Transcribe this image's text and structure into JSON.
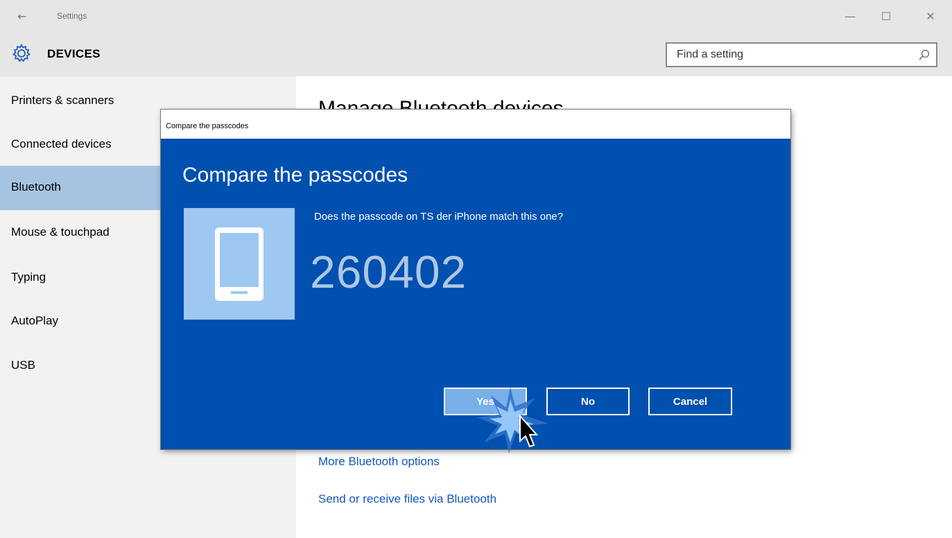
{
  "window": {
    "title": "Settings",
    "back_icon": "←",
    "minimize_icon": "—",
    "maximize_icon": "☐",
    "close_icon": "✕"
  },
  "header": {
    "title": "DEVICES",
    "search_placeholder": "Find a setting"
  },
  "sidebar": {
    "items": [
      {
        "label": "Printers & scanners"
      },
      {
        "label": "Connected devices"
      },
      {
        "label": "Bluetooth",
        "selected": true
      },
      {
        "label": "Mouse & touchpad"
      },
      {
        "label": "Typing"
      },
      {
        "label": "AutoPlay"
      },
      {
        "label": "USB"
      }
    ]
  },
  "content": {
    "heading": "Manage Bluetooth devices",
    "links": [
      "More Bluetooth options",
      "Send or receive files via Bluetooth"
    ]
  },
  "dialog": {
    "window_title": "Compare the passcodes",
    "heading": "Compare the passcodes",
    "question": "Does the passcode on TS der iPhone match this one?",
    "passcode": "260402",
    "buttons": {
      "yes": "Yes",
      "no": "No",
      "cancel": "Cancel"
    }
  },
  "colors": {
    "dialog_bg": "#0050b0",
    "selected_nav": "#a4c4e2",
    "link": "#1357bd",
    "device_tile": "#9ec8f1"
  }
}
